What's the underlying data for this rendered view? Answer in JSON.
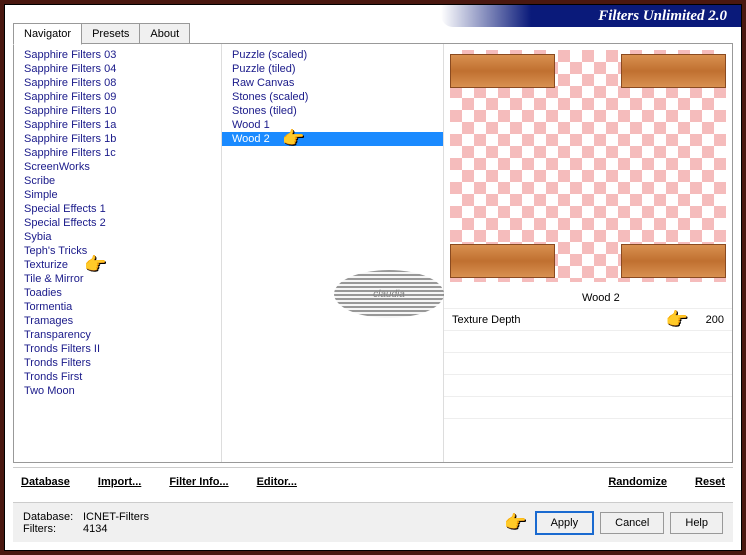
{
  "app_title": "Filters Unlimited 2.0",
  "tabs": {
    "t0": "Navigator",
    "t1": "Presets",
    "t2": "About"
  },
  "col1": {
    "items": [
      "Sapphire Filters 03",
      "Sapphire Filters 04",
      "Sapphire Filters 08",
      "Sapphire Filters 09",
      "Sapphire Filters 10",
      "Sapphire Filters 1a",
      "Sapphire Filters 1b",
      "Sapphire Filters 1c",
      "ScreenWorks",
      "Scribe",
      "Simple",
      "Special Effects 1",
      "Special Effects 2",
      "Sybia",
      "Teph's Tricks",
      "Texturize",
      "Tile & Mirror",
      "Toadies",
      "Tormentia",
      "Tramages",
      "Transparency",
      "Tronds Filters II",
      "Tronds Filters",
      "Tronds First",
      "Two Moon"
    ],
    "selected": "Texturize"
  },
  "col2": {
    "items": [
      "Puzzle (scaled)",
      "Puzzle (tiled)",
      "Raw Canvas",
      "Stones (scaled)",
      "Stones (tiled)",
      "Wood 1",
      "Wood 2"
    ],
    "selected": "Wood 2"
  },
  "filter_name": "Wood 2",
  "params": {
    "p0": {
      "label": "Texture Depth",
      "value": "200"
    }
  },
  "bottom": {
    "b0": "Database",
    "b1": "Import...",
    "b2": "Filter Info...",
    "b3": "Editor...",
    "b4": "Randomize",
    "b5": "Reset"
  },
  "status": {
    "db_lbl": "Database:",
    "db_val": "ICNET-Filters",
    "flt_lbl": "Filters:",
    "flt_val": "4134"
  },
  "buttons": {
    "apply": "Apply",
    "cancel": "Cancel",
    "help": "Help"
  },
  "watermark": "claudia"
}
